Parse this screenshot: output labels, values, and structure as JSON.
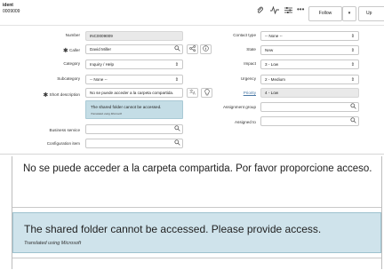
{
  "header": {
    "title_line1": "ident",
    "title_line2": "0009009",
    "follow_label": "Follow",
    "follow_arrow": "▾",
    "update_label": "Up",
    "icons": [
      "paperclip-icon",
      "activity-icon",
      "settings-icon",
      "more-icon"
    ]
  },
  "form": {
    "number": {
      "label": "Number",
      "value": "INC0009009"
    },
    "caller": {
      "label": "Caller",
      "value": "David Miller"
    },
    "category": {
      "label": "Category",
      "value": "Inquiry / Help"
    },
    "subcategory": {
      "label": "Subcategory",
      "value": "-- None --"
    },
    "short_description": {
      "label": "Short description",
      "value": "No se puede acceder a la carpeta compartida."
    },
    "translation": {
      "text": "The shared folder cannot be accessed.",
      "note": "Translated using Microsoft"
    },
    "business_service": {
      "label": "Business service",
      "value": ""
    },
    "configuration_item": {
      "label": "Configuration item",
      "value": ""
    },
    "contact_type": {
      "label": "Contact type",
      "value": "-- None --"
    },
    "state": {
      "label": "State",
      "value": "New"
    },
    "impact": {
      "label": "Impact",
      "value": "3 - Low"
    },
    "urgency": {
      "label": "Urgency",
      "value": "2 - Medium"
    },
    "priority": {
      "label": "Priority",
      "value": "4 - Low"
    },
    "assignment_group": {
      "label": "Assignment group",
      "value": ""
    },
    "assigned_to": {
      "label": "Assigned to",
      "value": ""
    }
  },
  "zoom": {
    "input_text": "No se puede acceder a la carpeta compartida. Por favor proporcione acceso.",
    "translated_text": "The shared folder cannot be accessed. Please provide access.",
    "translated_note": "Translated using Microsoft"
  },
  "colors": {
    "info_bg": "#c4dde6",
    "link": "#4a78a5"
  }
}
